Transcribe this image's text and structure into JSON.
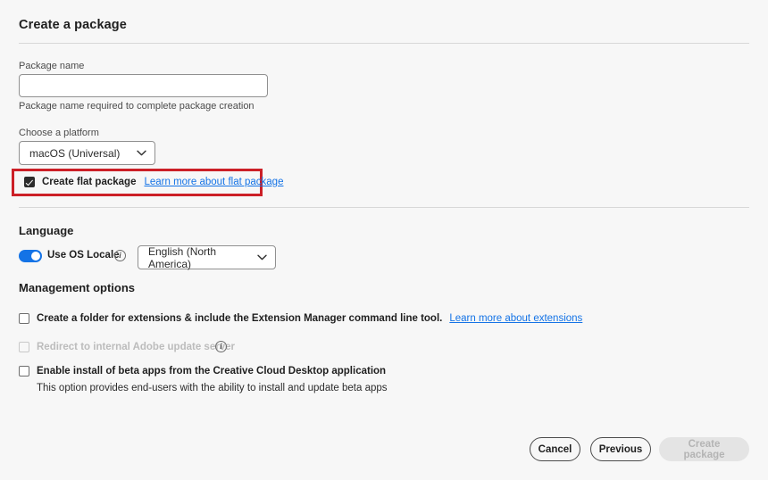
{
  "header": {
    "title": "Create a package"
  },
  "package_name": {
    "label": "Package name",
    "value": "",
    "placeholder": "",
    "helper": "Package name required to complete package creation"
  },
  "platform": {
    "label": "Choose a platform",
    "selected": "macOS (Universal)",
    "options": [
      "macOS (Universal)"
    ],
    "chevron_icon": "chevron-down-icon"
  },
  "flat_package": {
    "checked": true,
    "label": "Create flat package",
    "link": "Learn more about flat package",
    "highlight_color": "#CC2027"
  },
  "language": {
    "heading": "Language",
    "toggle": {
      "label": "Use OS Locale",
      "on": true,
      "accent_color": "#1473E6"
    },
    "info_icon": "info-icon",
    "select": {
      "selected": "English (North America)",
      "options": [
        "English (North America)"
      ],
      "chevron_icon": "chevron-down-icon"
    }
  },
  "management": {
    "heading": "Management options",
    "items": [
      {
        "label": "Create a folder for extensions & include the Extension Manager command line tool.",
        "link": "Learn more about extensions",
        "checked": false,
        "disabled": false
      },
      {
        "label": "Redirect to internal Adobe update server",
        "checked": false,
        "disabled": true,
        "info_icon": "info-icon"
      },
      {
        "label": "Enable install of beta apps from the Creative Cloud Desktop application",
        "checked": false,
        "disabled": false,
        "description": "This option provides end-users with the ability to install and update beta apps"
      }
    ]
  },
  "footer": {
    "cancel_label": "Cancel",
    "previous_label": "Previous",
    "create_label": "Create package"
  },
  "theme": {
    "background": "#F7F7F7",
    "link_color": "#1473E6",
    "accent_color": "#1473E6",
    "highlight_color": "#CC2027"
  }
}
